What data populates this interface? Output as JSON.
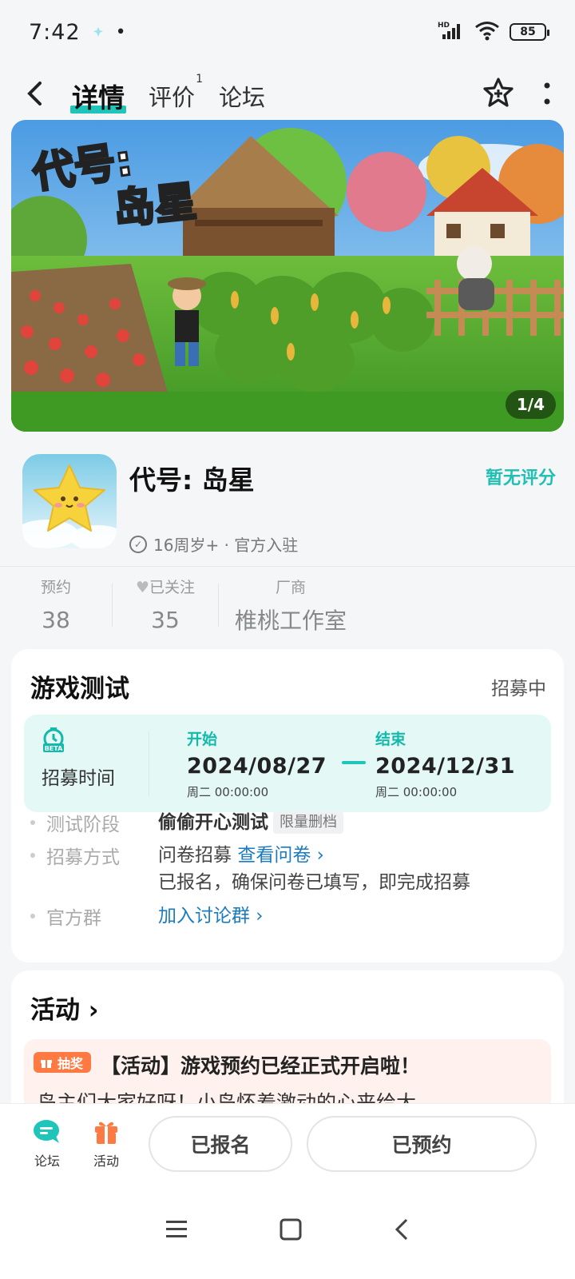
{
  "status_bar": {
    "time": "7:42",
    "dot": "•",
    "network": "HD",
    "battery": "85"
  },
  "header": {
    "back_icon": "back-arrow-icon",
    "tabs": [
      {
        "label": "详情",
        "active": true
      },
      {
        "label": "评价",
        "badge": "1"
      },
      {
        "label": "论坛"
      }
    ],
    "star_icon": "star-plus-icon",
    "more_icon": "more-vertical-icon"
  },
  "banner": {
    "counter": "1/4",
    "title_art": "代号:岛星"
  },
  "game": {
    "title": "代号: 岛星",
    "score_text": "暂无评分",
    "meta": "16周岁+ · 官方入驻"
  },
  "stats": {
    "reserve": {
      "label": "预约",
      "value": "38"
    },
    "follow": {
      "label": "已关注",
      "value": "35"
    },
    "vendor": {
      "label": "厂商",
      "value": "椎桃工作室"
    }
  },
  "test_card": {
    "title": "游戏测试",
    "status": "招募中",
    "recruit_label": "招募时间",
    "start": {
      "caption": "开始",
      "date": "2024/08/27",
      "sub": "周二  00:00:00"
    },
    "end": {
      "caption": "结束",
      "date": "2024/12/31",
      "sub": "周二  00:00:00"
    },
    "stage_label": "测试阶段",
    "stage_value": "偷偷开心测试",
    "stage_tag": "限量删档",
    "method_label": "招募方式",
    "method_value": "问卷招募",
    "method_link": "查看问卷 ›",
    "method_note": "已报名，确保问卷已填写，即完成招募",
    "group_label": "官方群",
    "group_link": "加入讨论群 ›"
  },
  "activity": {
    "title": "活动 ›",
    "badge": "抽奖",
    "headline": "【活动】游戏预约已经正式开启啦！",
    "desc": "岛主们大家好呀！小岛怀着激动的心来给大"
  },
  "bottom_bar": {
    "forum_label": "论坛",
    "activity_label": "活动",
    "signed_up": "已报名",
    "reserved": "已预约"
  },
  "colors": {
    "accent": "#1fc5b8",
    "link": "#1a7bc0",
    "lottery": "#ff7a42"
  }
}
